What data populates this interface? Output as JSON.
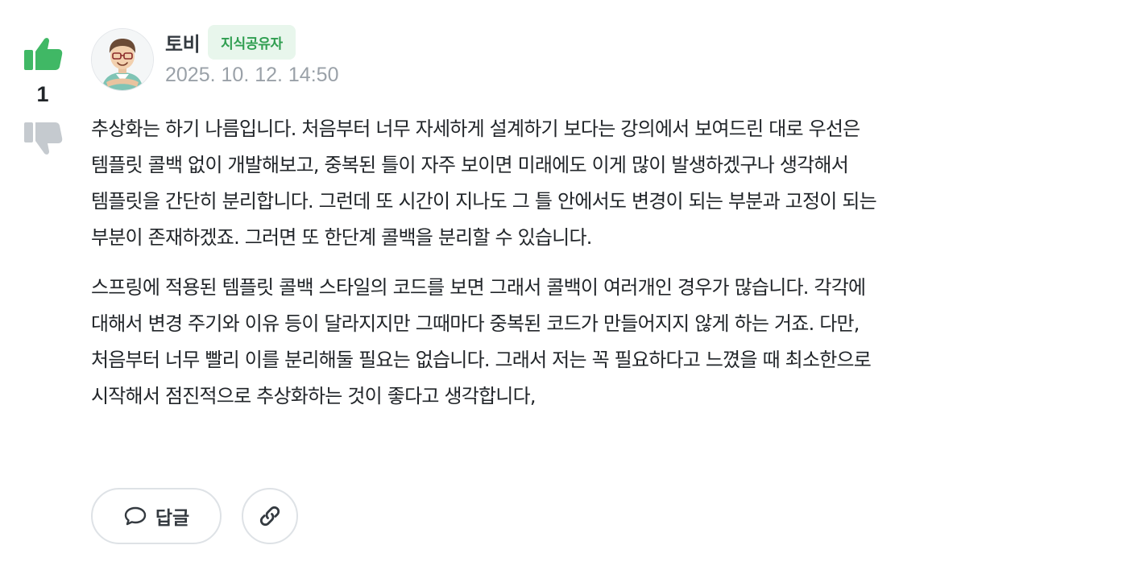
{
  "vote": {
    "count": "1",
    "like_icon": "thumbs-up-icon",
    "dislike_icon": "thumbs-down-icon",
    "like_color": "#40b865",
    "dislike_color": "#c5cacf"
  },
  "author": {
    "name": "토비",
    "badge": "지식공유자",
    "timestamp": "2025. 10. 12. 14:50",
    "avatar_icon": "avatar-illustration"
  },
  "body": {
    "paragraphs": [
      "추상화는 하기 나름입니다. 처음부터 너무 자세하게 설계하기 보다는 강의에서 보여드린 대로 우선은\n템플릿 콜백 없이 개발해보고, 중복된 틀이 자주 보이면 미래에도 이게 많이 발생하겠구나 생각해서\n템플릿을 간단히 분리합니다. 그런데 또 시간이 지나도 그 틀 안에서도 변경이 되는 부분과 고정이 되는\n부분이 존재하겠죠. 그러면 또 한단계 콜백을 분리할 수 있습니다.",
      "스프링에 적용된 템플릿 콜백 스타일의 코드를 보면 그래서 콜백이 여러개인 경우가 많습니다. 각각에\n대해서 변경 주기와 이유 등이 달라지지만 그때마다 중복된 코드가 만들어지지 않게 하는 거죠. 다만,\n처음부터 너무 빨리 이를 분리해둘 필요는 없습니다. 그래서 저는 꼭 필요하다고 느꼈을 때 최소한으로\n시작해서 점진적으로 추상화하는 것이 좋다고 생각합니다,"
    ]
  },
  "actions": {
    "reply_label": "답글",
    "reply_icon": "speech-bubble-icon",
    "link_icon": "link-icon"
  }
}
